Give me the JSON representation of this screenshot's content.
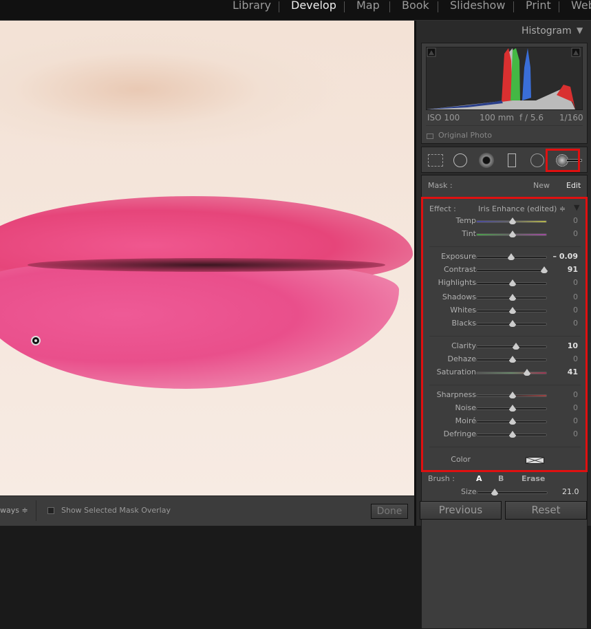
{
  "modules": [
    {
      "label": "Library",
      "active": false
    },
    {
      "label": "Develop",
      "active": true
    },
    {
      "label": "Map",
      "active": false
    },
    {
      "label": "Book",
      "active": false
    },
    {
      "label": "Slideshow",
      "active": false
    },
    {
      "label": "Print",
      "active": false
    },
    {
      "label": "Web",
      "active": false
    }
  ],
  "histogram": {
    "title": "Histogram",
    "iso": "ISO 100",
    "focal": "100 mm",
    "aperture": "f / 5.6",
    "shutter": "1/160",
    "original_photo": "Original Photo"
  },
  "tools": [
    "crop-overlay-icon",
    "spot-removal-icon",
    "red-eye-icon",
    "graduated-filter-icon",
    "radial-filter-icon",
    "adjustment-brush-icon"
  ],
  "mask": {
    "label": "Mask :",
    "new": "New",
    "edit": "Edit"
  },
  "effect": {
    "label": "Effect :",
    "preset": "Iris Enhance (edited) ≑"
  },
  "sliders": [
    {
      "label": "Temp",
      "value": "0",
      "pos": 0,
      "on": false,
      "track": "temp"
    },
    {
      "label": "Tint",
      "value": "0",
      "pos": 0,
      "on": false,
      "track": "tint"
    },
    {
      "label": "Exposure",
      "value": "– 0.09",
      "pos": -0.0225,
      "on": true
    },
    {
      "label": "Contrast",
      "value": "91",
      "pos": 0.91,
      "on": true
    },
    {
      "label": "Highlights",
      "value": "0",
      "pos": 0,
      "on": false
    },
    {
      "label": "Shadows",
      "value": "0",
      "pos": 0,
      "on": false
    },
    {
      "label": "Whites",
      "value": "0",
      "pos": 0,
      "on": false
    },
    {
      "label": "Blacks",
      "value": "0",
      "pos": 0,
      "on": false
    },
    {
      "label": "Clarity",
      "value": "10",
      "pos": 0.1,
      "on": true
    },
    {
      "label": "Dehaze",
      "value": "0",
      "pos": 0,
      "on": false
    },
    {
      "label": "Saturation",
      "value": "41",
      "pos": 0.41,
      "on": true,
      "track": "sat"
    },
    {
      "label": "Sharpness",
      "value": "0",
      "pos": 0,
      "on": false,
      "track": "sharp"
    },
    {
      "label": "Noise",
      "value": "0",
      "pos": 0,
      "on": false
    },
    {
      "label": "Moiré",
      "value": "0",
      "pos": 0,
      "on": false
    },
    {
      "label": "Defringe",
      "value": "0",
      "pos": 0,
      "on": false
    }
  ],
  "color_label": "Color",
  "brush": {
    "label": "Brush :",
    "a": "A",
    "b": "B",
    "erase": "Erase",
    "size_label": "Size",
    "size_value": "21.0"
  },
  "buttons": {
    "previous": "Previous",
    "reset": "Reset",
    "done": "Done"
  },
  "toolbar": {
    "show_edit_pins": "ways ≑",
    "overlay_label": "Show Selected Mask Overlay"
  },
  "colors": {
    "highlight_frame": "#e01010"
  }
}
